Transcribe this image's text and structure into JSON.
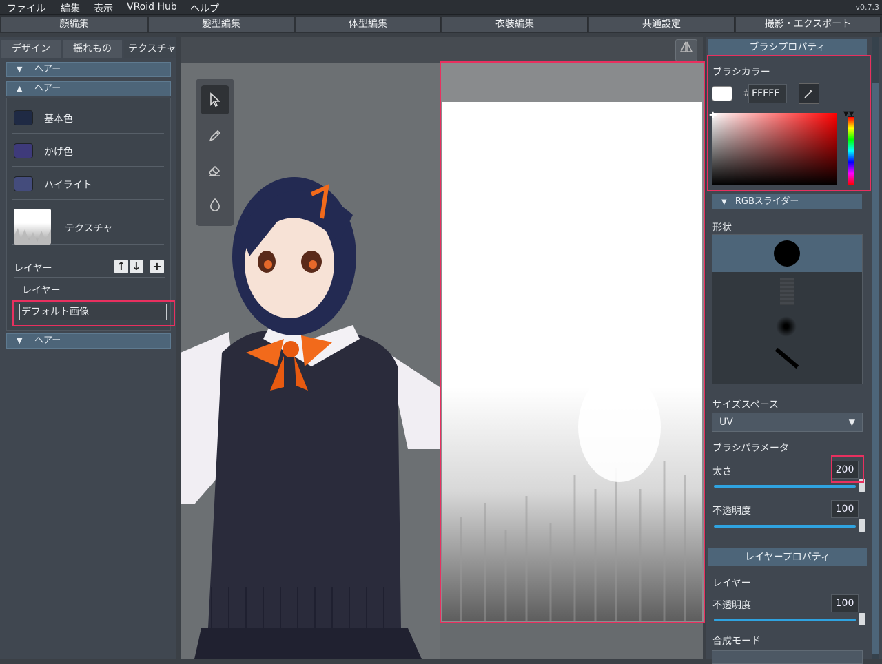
{
  "menu": {
    "file": "ファイル",
    "edit": "編集",
    "view": "表示",
    "hub": "VRoid Hub",
    "help": "ヘルプ",
    "version": "v0.7.3"
  },
  "tabs": [
    "顔編集",
    "髪型編集",
    "体型編集",
    "衣装編集",
    "共通設定",
    "撮影・エクスポート"
  ],
  "subtabs": [
    "デザイン",
    "揺れもの",
    "テクスチャ"
  ],
  "left": {
    "sect1": "ヘアー",
    "sect2": "ヘアー",
    "sect3": "ヘアー",
    "colors": [
      {
        "label": "基本色",
        "color": "#1f2a44"
      },
      {
        "label": "かげ色",
        "color": "#3e3a7a"
      },
      {
        "label": "ハイライト",
        "color": "#444c7c"
      }
    ],
    "texture_label": "テクスチャ",
    "layers_label": "レイヤー",
    "layer_group": "レイヤー",
    "layer_name": "デフォルト画像"
  },
  "tools": [
    "select-tool",
    "pen-tool",
    "eraser-tool",
    "fill-tool"
  ],
  "right": {
    "brush_props": "ブラシプロパティ",
    "brush_color": "ブラシカラー",
    "hex_prefix": "#",
    "hex_value": "FFFFF",
    "rgb_sliders": "RGBスライダー",
    "shape": "形状",
    "size_space": "サイズスペース",
    "size_space_value": "UV",
    "brush_params": "ブラシパラメータ",
    "thickness": "太さ",
    "thickness_value": "200",
    "thickness_pct": 1.0,
    "opacity": "不透明度",
    "opacity_value": "100",
    "opacity_pct": 1.0,
    "layer_props": "レイヤープロパティ",
    "layer": "レイヤー",
    "layer_opacity": "不透明度",
    "layer_opacity_value": "100",
    "layer_opacity_pct": 1.0,
    "blend_mode": "合成モード"
  },
  "accent": "#e8305f",
  "slider_color": "#2fa3e0"
}
